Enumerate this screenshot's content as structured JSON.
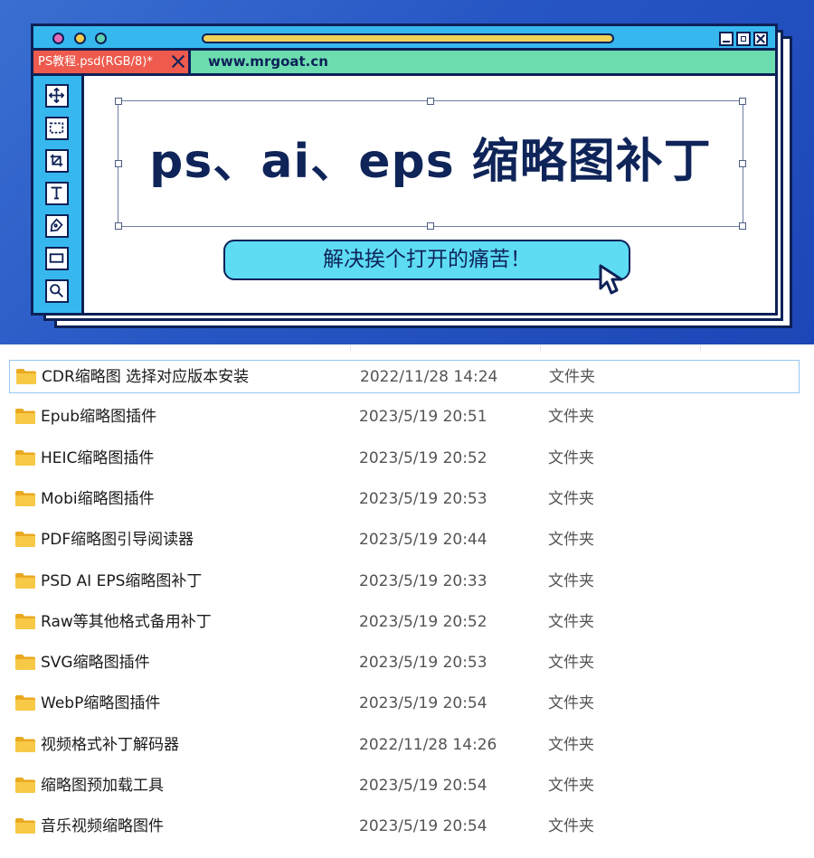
{
  "window": {
    "document_tab": "PS教程.psd(RGB/8)*",
    "url": "www.mrgoat.cn"
  },
  "toolbar": {
    "tools": [
      "move",
      "marquee",
      "crop",
      "text",
      "pen",
      "rectangle",
      "zoom"
    ]
  },
  "banner": {
    "headline": "ps、ai、eps 缩略图补丁",
    "cta": "解决挨个打开的痛苦！",
    "colors": {
      "background": "#2756c4",
      "titlebar": "#36b8ef",
      "tabbar": "#6dddb0",
      "doc_tab": "#ee5a4d",
      "cta": "#5ddcf3",
      "ink": "#0d2157"
    }
  },
  "files": [
    {
      "name": "CDR缩略图 选择对应版本安装",
      "date": "2022/11/28 14:24",
      "type": "文件夹",
      "selected": true
    },
    {
      "name": "Epub缩略图插件",
      "date": "2023/5/19 20:51",
      "type": "文件夹"
    },
    {
      "name": "HEIC缩略图插件",
      "date": "2023/5/19 20:52",
      "type": "文件夹"
    },
    {
      "name": "Mobi缩略图插件",
      "date": "2023/5/19 20:53",
      "type": "文件夹"
    },
    {
      "name": "PDF缩略图引导阅读器",
      "date": "2023/5/19 20:44",
      "type": "文件夹"
    },
    {
      "name": "PSD AI EPS缩略图补丁",
      "date": "2023/5/19 20:33",
      "type": "文件夹"
    },
    {
      "name": "Raw等其他格式备用补丁",
      "date": "2023/5/19 20:52",
      "type": "文件夹"
    },
    {
      "name": "SVG缩略图插件",
      "date": "2023/5/19 20:53",
      "type": "文件夹"
    },
    {
      "name": "WebP缩略图插件",
      "date": "2023/5/19 20:54",
      "type": "文件夹"
    },
    {
      "name": "视频格式补丁解码器",
      "date": "2022/11/28 14:26",
      "type": "文件夹"
    },
    {
      "name": "缩略图预加载工具",
      "date": "2023/5/19 20:54",
      "type": "文件夹"
    },
    {
      "name": "音乐视频缩略图件",
      "date": "2023/5/19 20:54",
      "type": "文件夹"
    }
  ]
}
